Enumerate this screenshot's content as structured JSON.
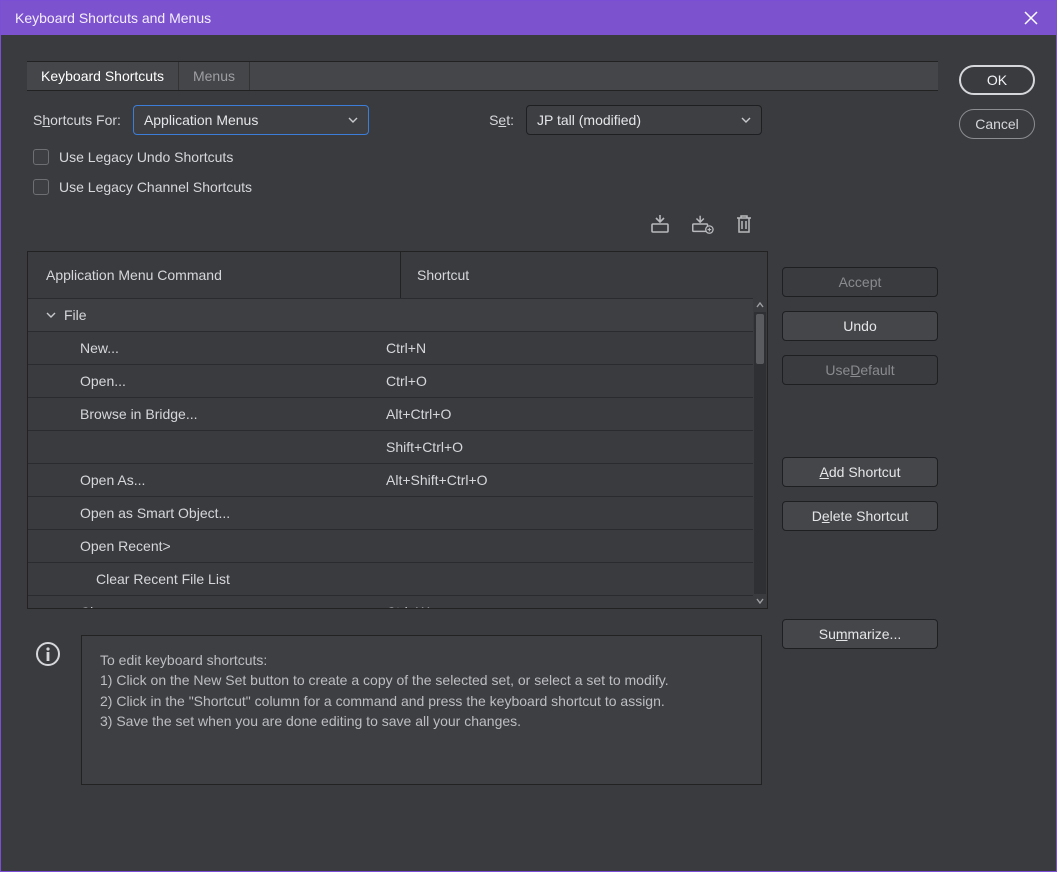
{
  "window": {
    "title": "Keyboard Shortcuts and Menus"
  },
  "tabs": {
    "shortcuts": "Keyboard Shortcuts",
    "menus": "Menus"
  },
  "shortcutsFor": {
    "label_pre": "S",
    "label_ul": "h",
    "label_post": "ortcuts For:",
    "value": "Application Menus"
  },
  "set": {
    "label_pre": "S",
    "label_ul": "e",
    "label_post": "t:",
    "value": "JP tall (modified)"
  },
  "checks": {
    "legacyUndo": "Use Legacy Undo Shortcuts",
    "legacyChannel": "Use Legacy Channel Shortcuts"
  },
  "columns": {
    "command": "Application Menu Command",
    "shortcut": "Shortcut"
  },
  "rows": [
    {
      "type": "group",
      "label": "File",
      "shortcut": ""
    },
    {
      "type": "item1",
      "label": "New...",
      "shortcut": "Ctrl+N"
    },
    {
      "type": "item1",
      "label": "Open...",
      "shortcut": "Ctrl+O"
    },
    {
      "type": "item1",
      "label": "Browse in Bridge...",
      "shortcut": "Alt+Ctrl+O"
    },
    {
      "type": "item1",
      "label": "",
      "shortcut": "Shift+Ctrl+O"
    },
    {
      "type": "item1",
      "label": "Open As...",
      "shortcut": "Alt+Shift+Ctrl+O"
    },
    {
      "type": "item1",
      "label": "Open as Smart Object...",
      "shortcut": ""
    },
    {
      "type": "item1",
      "label": "Open Recent>",
      "shortcut": ""
    },
    {
      "type": "item2",
      "label": "Clear Recent File List",
      "shortcut": ""
    },
    {
      "type": "item1",
      "label": "Close",
      "shortcut": "Ctrl+W"
    }
  ],
  "buttons": {
    "ok": "OK",
    "cancel": "Cancel",
    "accept": "Accept",
    "undo": "Undo",
    "useDefault_pre": "Use ",
    "useDefault_ul": "D",
    "useDefault_post": "efault",
    "addShortcut_ul": "A",
    "addShortcut_post": "dd Shortcut",
    "deleteShortcut_pre": "D",
    "deleteShortcut_ul": "e",
    "deleteShortcut_post": "lete Shortcut",
    "summarize_pre": "Su",
    "summarize_ul": "m",
    "summarize_post": "marize..."
  },
  "iconTitles": {
    "saveSet": "Save set",
    "newSet": "Create new set",
    "deleteSet": "Delete set"
  },
  "info": {
    "l0": "To edit keyboard shortcuts:",
    "l1": "1) Click on the New Set button to create a copy of the selected set, or select a set to modify.",
    "l2": "2) Click in the \"Shortcut\" column for a command and press the keyboard shortcut to assign.",
    "l3": "3) Save the set when you are done editing to save all your changes."
  }
}
